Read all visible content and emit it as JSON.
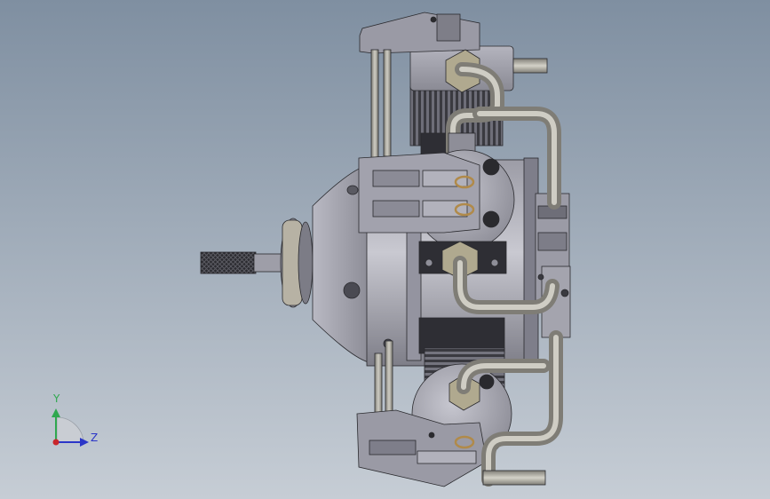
{
  "viewport": {
    "background_top": "#7f8fa1",
    "background_bottom": "#c6cdd5"
  },
  "triad": {
    "y_label": "Y",
    "z_label": "Z",
    "y_color": "#2fa84f",
    "z_color": "#2b36c8",
    "x_color": "#c8262b"
  },
  "model": {
    "metal_color": "#a9a9b3",
    "dark_color": "#2a2a2e",
    "pipe_color": "#a8a69e",
    "brass_color": "#b08a4a"
  }
}
